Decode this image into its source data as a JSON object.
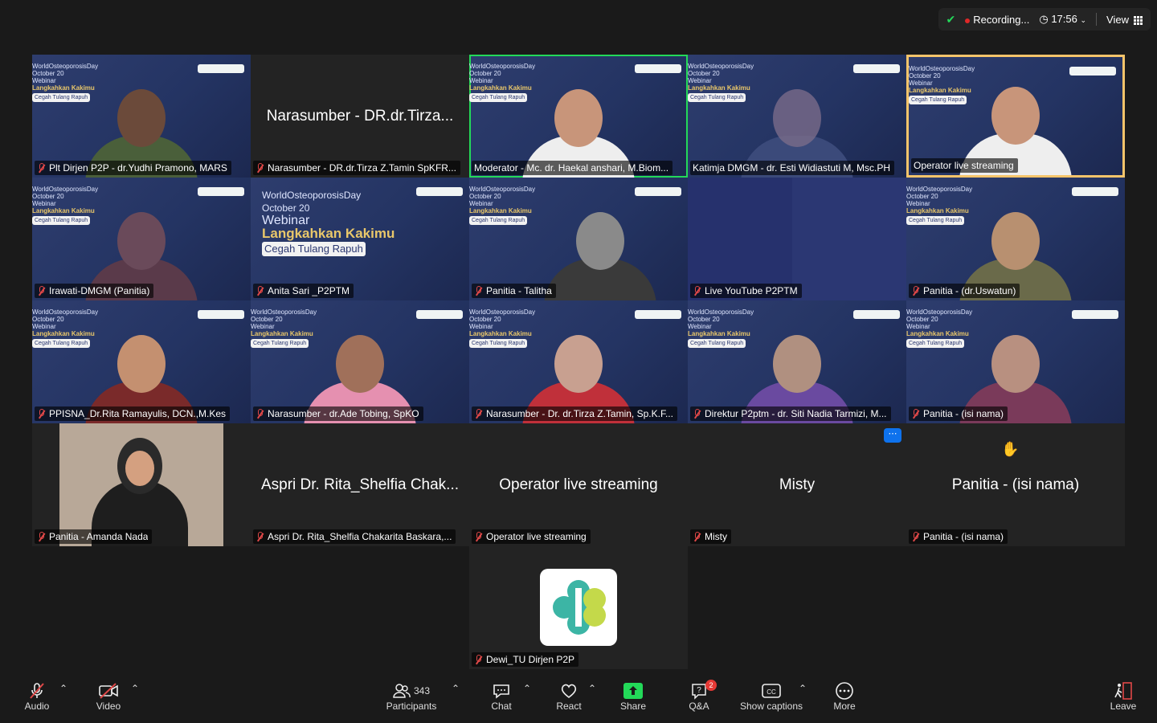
{
  "topbar": {
    "recording_label": "Recording...",
    "time": "17:56",
    "view_label": "View"
  },
  "tiles": [
    {
      "label": "Plt Dirjen P2P - dr.Yudhi Pramono, MARS"
    },
    {
      "label": "Narasumber - DR.dr.Tirza Z.Tamin SpKFR...",
      "bigname": "Narasumber - DR.dr.Tirza..."
    },
    {
      "label": "Moderator - Mc. dr. Haekal anshari, M.Biom..."
    },
    {
      "label": "Katimja DMGM - dr. Esti Widiastuti M, Msc.PH"
    },
    {
      "label": "Operator live streaming"
    },
    {
      "label": "Irawati-DMGM (Panitia)"
    },
    {
      "label": "Anita Sari _P2PTM"
    },
    {
      "label": "Panitia - Talitha"
    },
    {
      "label": "Live YouTube P2PTM"
    },
    {
      "label": "Panitia - (dr.Uswatun)"
    },
    {
      "label": "PPISNA_Dr.Rita Ramayulis, DCN.,M.Kes"
    },
    {
      "label": "Narasumber - dr.Ade Tobing, SpKO"
    },
    {
      "label": "Narasumber - Dr. dr.Tirza Z.Tamin, Sp.K.F..."
    },
    {
      "label": "Direktur P2ptm - dr. Siti Nadia Tarmizi, M..."
    },
    {
      "label": "Panitia - (isi nama)"
    },
    {
      "label": "Panitia - Amanda Nada"
    },
    {
      "label": "Aspri Dr. Rita_Shelfia Chakarita Baskara,...",
      "bigname": "Aspri Dr. Rita_Shelfia Chak..."
    },
    {
      "label": "Operator live streaming",
      "bigname": "Operator live streaming"
    },
    {
      "label": "Misty",
      "bigname": "Misty"
    },
    {
      "label": "Panitia - (isi nama)",
      "bigname": "Panitia - (isi nama)"
    },
    {
      "label": "Dewi_TU Dirjen P2P"
    }
  ],
  "banner": {
    "day": "WorldOsteoporosisDay",
    "date": "October 20",
    "webinar": "Webinar",
    "title": "Langkahkan Kakimu",
    "subtitle": "Cegah Tulang Rapuh"
  },
  "toolbar": {
    "audio": "Audio",
    "video": "Video",
    "participants": "Participants",
    "participants_count": "343",
    "chat": "Chat",
    "react": "React",
    "share": "Share",
    "qa": "Q&A",
    "qa_badge": "2",
    "captions": "Show captions",
    "more": "More",
    "leave": "Leave"
  },
  "colors": {
    "accent": "#23d959",
    "mute": "#e04848",
    "share": "#23d959",
    "badge": "#e53935",
    "highlight": "#f5c46a"
  }
}
